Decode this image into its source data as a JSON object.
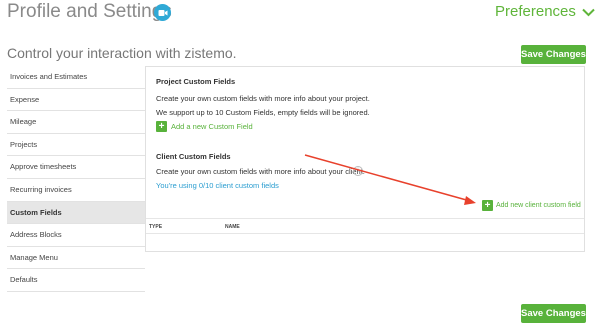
{
  "header": {
    "title": "Profile and Settings",
    "preferences_label": "Preferences",
    "subtitle": "Control your interaction with zistemo.",
    "save_label": "Save Changes"
  },
  "sidebar": {
    "items": [
      {
        "label": "Invoices and Estimates",
        "active": false
      },
      {
        "label": "Expense",
        "active": false
      },
      {
        "label": "Mileage",
        "active": false
      },
      {
        "label": "Projects",
        "active": false
      },
      {
        "label": "Approve timesheets",
        "active": false
      },
      {
        "label": "Recurring invoices",
        "active": false
      },
      {
        "label": "Custom Fields",
        "active": true
      },
      {
        "label": "Address Blocks",
        "active": false
      },
      {
        "label": "Manage Menu",
        "active": false
      },
      {
        "label": "Defaults",
        "active": false
      }
    ]
  },
  "project_fields": {
    "heading": "Project Custom Fields",
    "line1": "Create your own custom fields with more info about your project.",
    "line2": "We support up to 10 Custom Fields, empty fields will be ignored.",
    "add_label": "Add a new Custom Field"
  },
  "client_fields": {
    "heading": "Client Custom Fields",
    "line1": "Create your own custom fields with more info about your client.",
    "usage": "You're using 0/10 client custom fields",
    "add_label": "Add new client custom field"
  },
  "table": {
    "columns": [
      "TYPE",
      "NAME"
    ]
  },
  "colors": {
    "accent_green": "#58b23b",
    "link_blue": "#2a9dd0",
    "arrow_red": "#e8412c"
  },
  "footer": {
    "save_label": "Save Changes"
  }
}
